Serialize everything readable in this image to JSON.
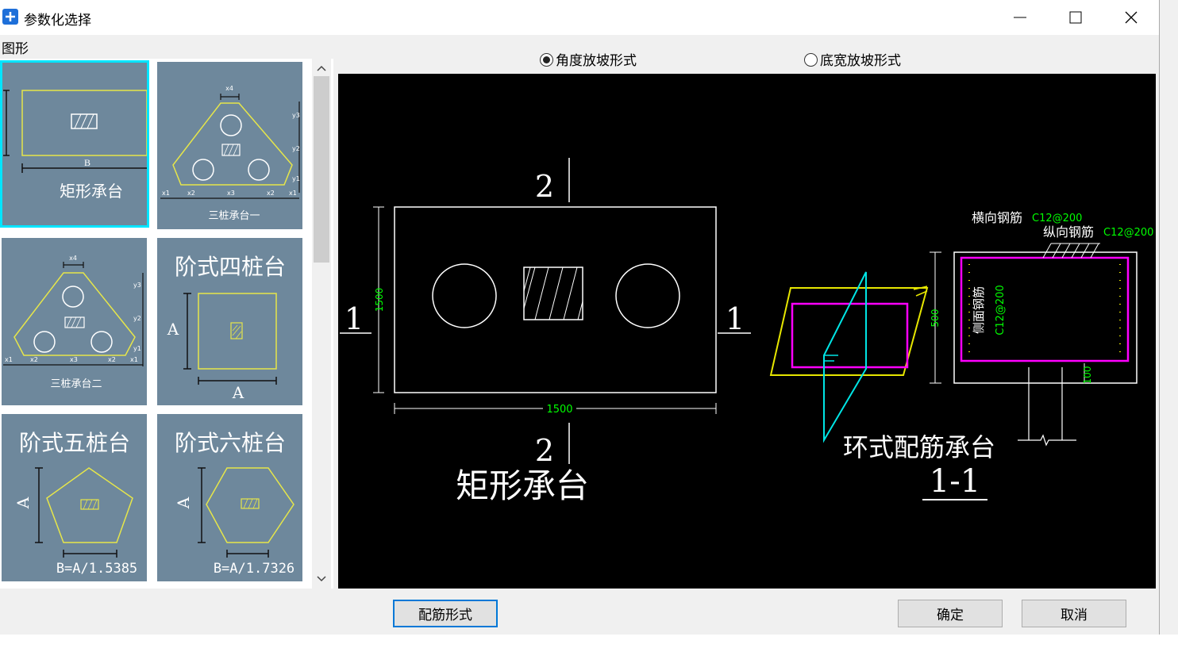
{
  "window": {
    "title": "参数化选择"
  },
  "group_label": "图形",
  "thumbnails": [
    {
      "caption": "矩形承台",
      "dim_b": "B"
    },
    {
      "caption": "三桩承台一",
      "dims": [
        "x4",
        "y3",
        "y2",
        "y1",
        "x1",
        "x2",
        "x3",
        "x2",
        "x1"
      ]
    },
    {
      "caption": "三桩承台二",
      "dims": [
        "x4",
        "y3",
        "y2",
        "y1",
        "x1",
        "x2",
        "x3",
        "x2",
        "x1"
      ]
    },
    {
      "caption": "阶式四桩台",
      "dim_a": "A"
    },
    {
      "caption": "阶式五桩台",
      "dim_a": "A",
      "formula": "B=A/1.5385"
    },
    {
      "caption": "阶式六桩台",
      "dim_a": "A",
      "formula": "B=A/1.7326"
    }
  ],
  "radios": [
    {
      "label": "角度放坡形式",
      "checked": true
    },
    {
      "label": "底宽放坡形式",
      "checked": false
    }
  ],
  "drawing": {
    "section_2_top": "2",
    "section_2_bottom": "2",
    "section_1_left": "1",
    "section_1_right": "1",
    "dim_height": "1500",
    "dim_width": "1500",
    "name": "矩形承台",
    "ring_title": "环式配筋承台",
    "section_label": "1-1",
    "rebar_h_label": "横向钢筋",
    "rebar_h_val": "C12@200",
    "rebar_v_label": "纵向钢筋",
    "rebar_v_val": "C12@200",
    "rebar_side_label": "侧面钢筋",
    "rebar_side_val": "C12@200",
    "dim_500": "500",
    "dim_100": "100"
  },
  "buttons": {
    "rebar": "配筋形式",
    "ok": "确定",
    "cancel": "取消"
  }
}
